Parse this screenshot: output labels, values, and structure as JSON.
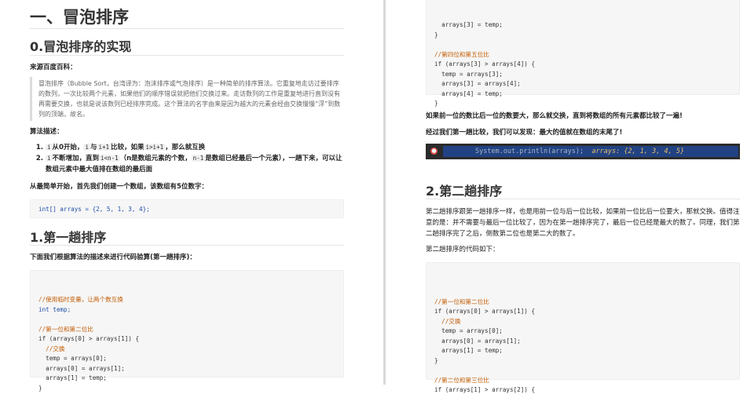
{
  "left": {
    "title": "一、冒泡排序",
    "section0": "0.冒泡排序的实现",
    "source_label": "来源百度百科：",
    "quote": "冒泡排序（Bubble Sort，台湾译为：泡沫排序或气泡排序）是一种简单的排序算法。它重复地走访过要排序的数列，一次比较两个元素，如果他们的顺序错误就把他们交换过来。走访数列的工作是重复地进行直到没有再需要交换，也就是说该数列已经排序完成。这个算法的名字由来是因为越大的元素会经由交换慢慢“浮”到数列的顶端，故名。",
    "algo_label": "算法描述：",
    "steps": [
      {
        "code1": "i",
        "t1": "从0开始，",
        "code2": "i",
        "t2": "与",
        "code3": "i+1",
        "t3": "比较，如果",
        "code4": "i>i+1",
        "t4": "，那么就互换"
      },
      {
        "code1": "i",
        "t1": "不断增加，直到",
        "code2": "i<n-1",
        "t2": "（n是数组元素的个数，",
        "code3": "n-1",
        "t3": "是数组已经最后一个元素），一趟下来，可以让数组元素中最大值排在数组的最后面"
      }
    ],
    "intro": "从最简单开始，首先我们创建一个数组，该数组有5位数字：",
    "array_code": "int[] arrays = {2, 5, 1, 3, 4};",
    "section1": "1.第一趟排序",
    "verify": "下面我们根据算法的描述来进行代码验算(第一趟排序)：",
    "code_lines": [
      "//使用临时变量，让两个数互换",
      "int temp;",
      "",
      "//第一位和第二位比",
      "if (arrays[0] > arrays[1]) {",
      "  //交换",
      "  temp = arrays[0];",
      "  arrays[0] = arrays[1];",
      "  arrays[1] = temp;",
      "}"
    ]
  },
  "right": {
    "top_code_lines": [
      "  arrays[3] = temp;",
      "}",
      "",
      "//第四位和第五位比",
      "if (arrays[3] > arrays[4]) {",
      "  temp = arrays[3];",
      "  arrays[3] = arrays[4];",
      "  arrays[4] = temp;",
      "}"
    ],
    "para1": "如果前一位的数比后一位的数要大，那么就交换，直到将数组的所有元素都比较了一遍!",
    "para2": "经过我们第一趟比较，我们可以发现：最大的值就在数组的末尾了!",
    "terminal_code": "System.out.println(arrays);",
    "terminal_result": "arrays: {2, 1, 3, 4, 5}",
    "section2": "2.第二趟排序",
    "desc": "第二趟排序跟第一趟排序一样，也是用前一位与后一位比较，如果前一位比后一位要大，那就交换。值得注意的是：并不需要与最后一位比较了，因为在第一趟排序完了，最后一位已经是最大的数了。同理，我们第二趟排序完了之后，倒数第二位也是第二大的数了。",
    "code_intro": "第二趟排序的代码如下：",
    "code_lines": [
      "",
      "//第一位和第二位比",
      "if (arrays[0] > arrays[1]) {",
      "  //交换",
      "  temp = arrays[0];",
      "  arrays[0] = arrays[1];",
      "  arrays[1] = temp;",
      "}",
      "",
      "//第二位和第三位比",
      "if (arrays[1] > arrays[2]) {"
    ]
  }
}
